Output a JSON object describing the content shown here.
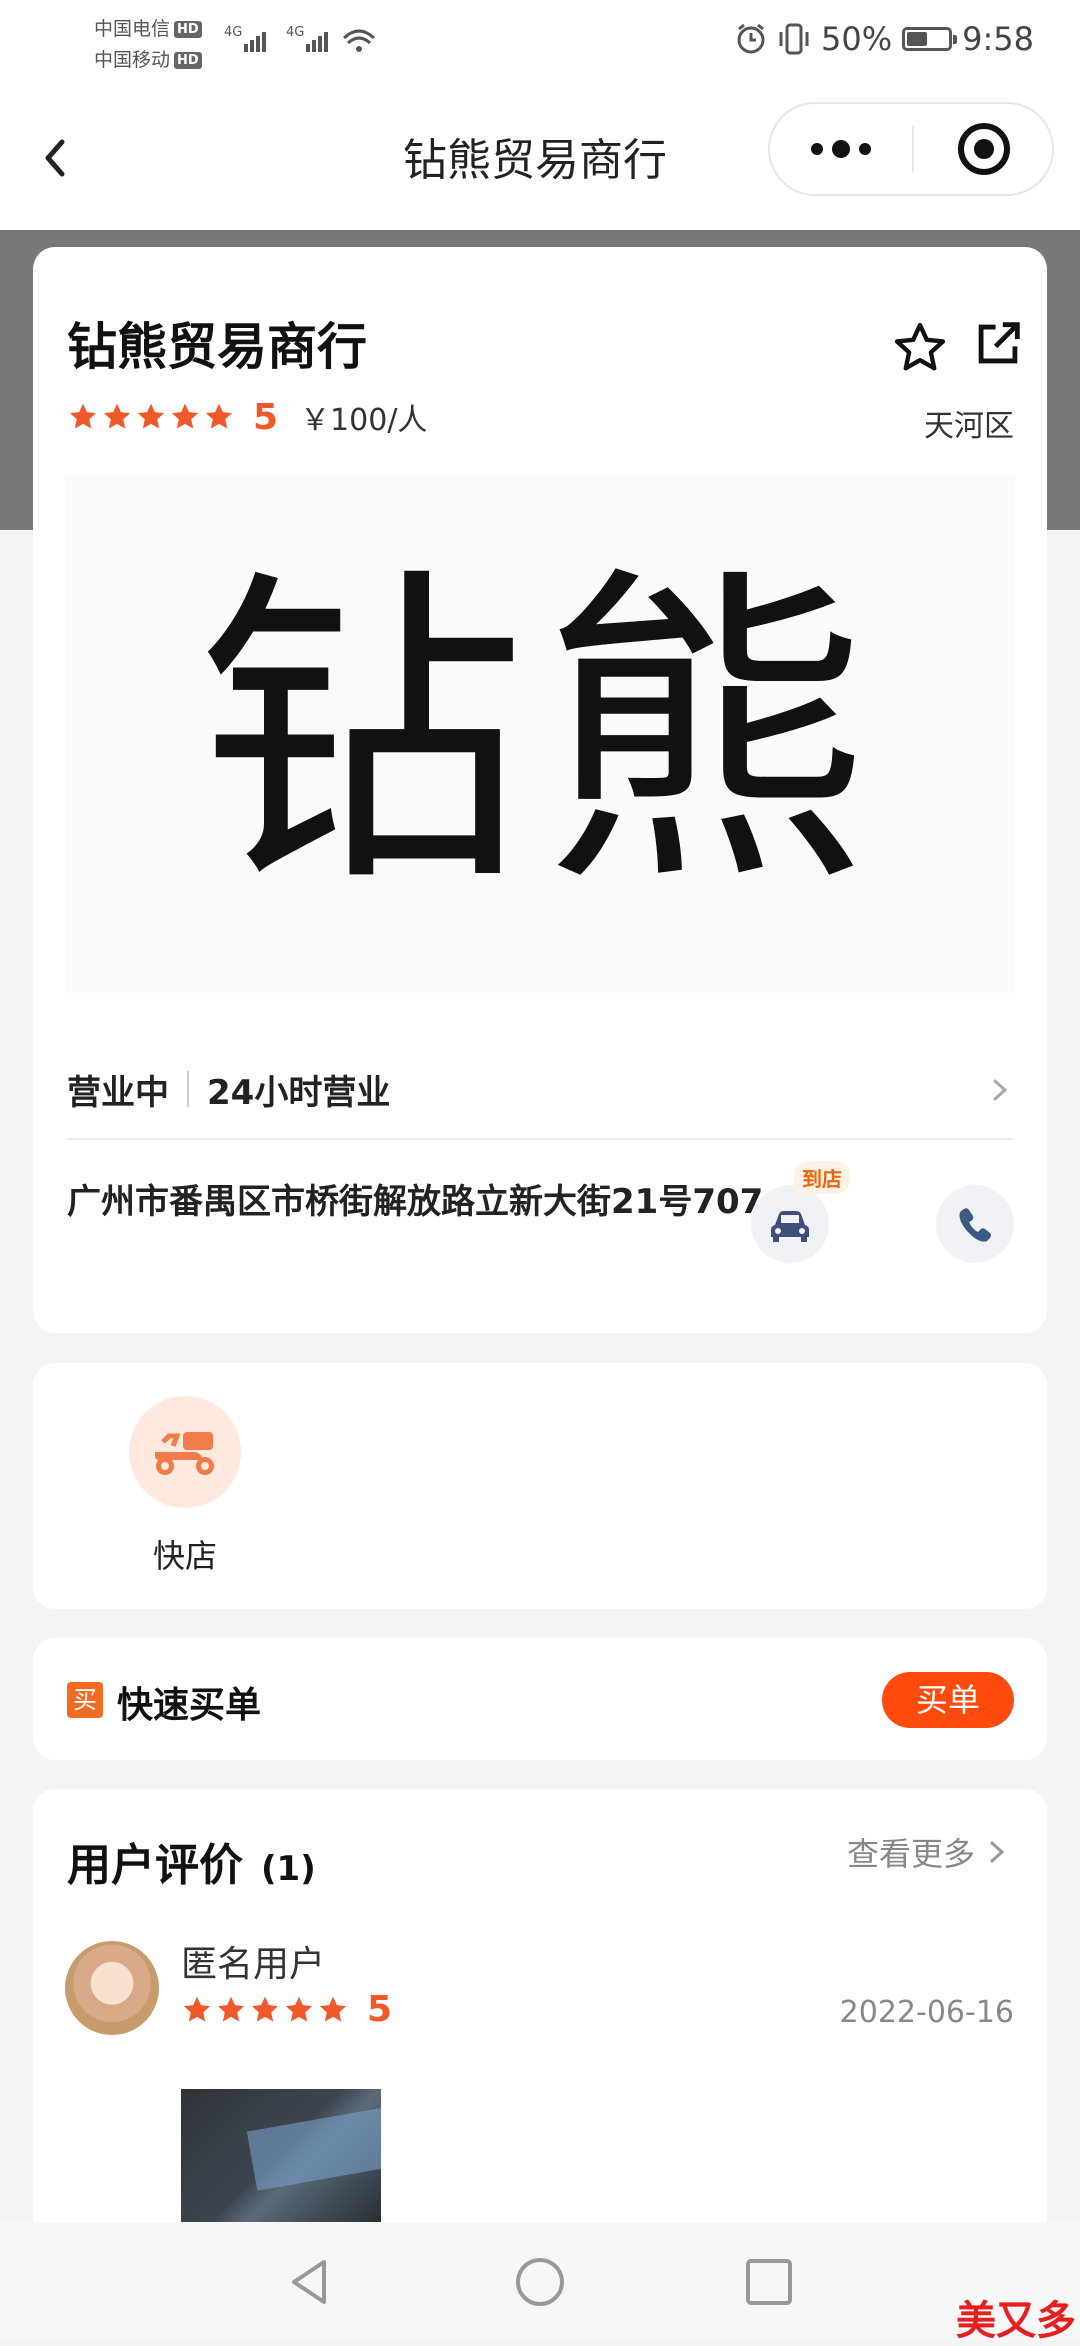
{
  "status_bar": {
    "carrier1": "中国电信",
    "carrier2": "中国移动",
    "hd": "HD",
    "network": "4G",
    "battery_percent": "50%",
    "battery_level": 0.5,
    "time": "9:58"
  },
  "navbar": {
    "title": "钻熊贸易商行",
    "more_icon": "more-dots-icon",
    "target_icon": "target-icon"
  },
  "shop": {
    "name": "钻熊贸易商行",
    "rating": "5",
    "rating_stars": 5,
    "price": "￥100/人",
    "district": "天河区",
    "logo_text": "钻熊"
  },
  "hours": {
    "status": "营业中",
    "detail": "24小时营业"
  },
  "address": {
    "text": "广州市番禺区市桥街解放路立新大街21号707",
    "nav_badge": "到店"
  },
  "services": [
    {
      "label": "快店",
      "icon": "scooter-icon"
    }
  ],
  "quick_buy": {
    "icon_text": "买",
    "title": "快速买单",
    "button": "买单"
  },
  "reviews": {
    "title": "用户评价",
    "count": "(1)",
    "see_more": "查看更多",
    "items": [
      {
        "user": "匿名用户",
        "score": "5",
        "date": "2022-06-16"
      }
    ]
  },
  "watermark": "美又多",
  "colors": {
    "accent": "#f05a2b",
    "buy_button": "#ff4a0e",
    "phone_icon": "#3d5a80"
  }
}
